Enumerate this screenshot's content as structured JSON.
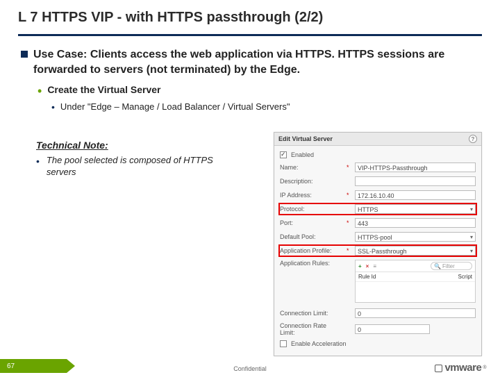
{
  "title": "L 7 HTTPS VIP - with HTTPS passthrough (2/2)",
  "bullet": {
    "usecase": "Use Case: Clients access the web application via HTTPS. HTTPS sessions are forwarded to servers (not terminated) by the Edge.",
    "sub1": "Create the Virtual Server",
    "sub2": "Under \"Edge – Manage /  Load Balancer / Virtual Servers\""
  },
  "technote": {
    "heading": "Technical Note:",
    "item": "The pool selected is composed of HTTPS servers"
  },
  "dialog": {
    "title": "Edit Virtual Server",
    "fields": {
      "enabled_label": "Enabled",
      "name_label": "Name:",
      "name_value": "VIP-HTTPS-Passthrough",
      "desc_label": "Description:",
      "ip_label": "IP Address:",
      "ip_value": "172.16.10.40",
      "proto_label": "Protocol:",
      "proto_value": "HTTPS",
      "port_label": "Port:",
      "port_value": "443",
      "pool_label": "Default Pool:",
      "pool_value": "HTTPS-pool",
      "approf_label": "Application Profile:",
      "approf_value": "SSL-Passthrough",
      "apprules_label": "Application Rules:",
      "rules_filter_placeholder": "Filter",
      "rules_col1": "Rule Id",
      "rules_col2": "Script",
      "connlim_label": "Connection Limit:",
      "connlim_value": "0",
      "connrate_label": "Connection Rate Limit:",
      "connrate_value": "0",
      "accel_label": "Enable Acceleration"
    }
  },
  "footer": {
    "page": "67",
    "confidential": "Confidential",
    "brand": "vmware"
  }
}
